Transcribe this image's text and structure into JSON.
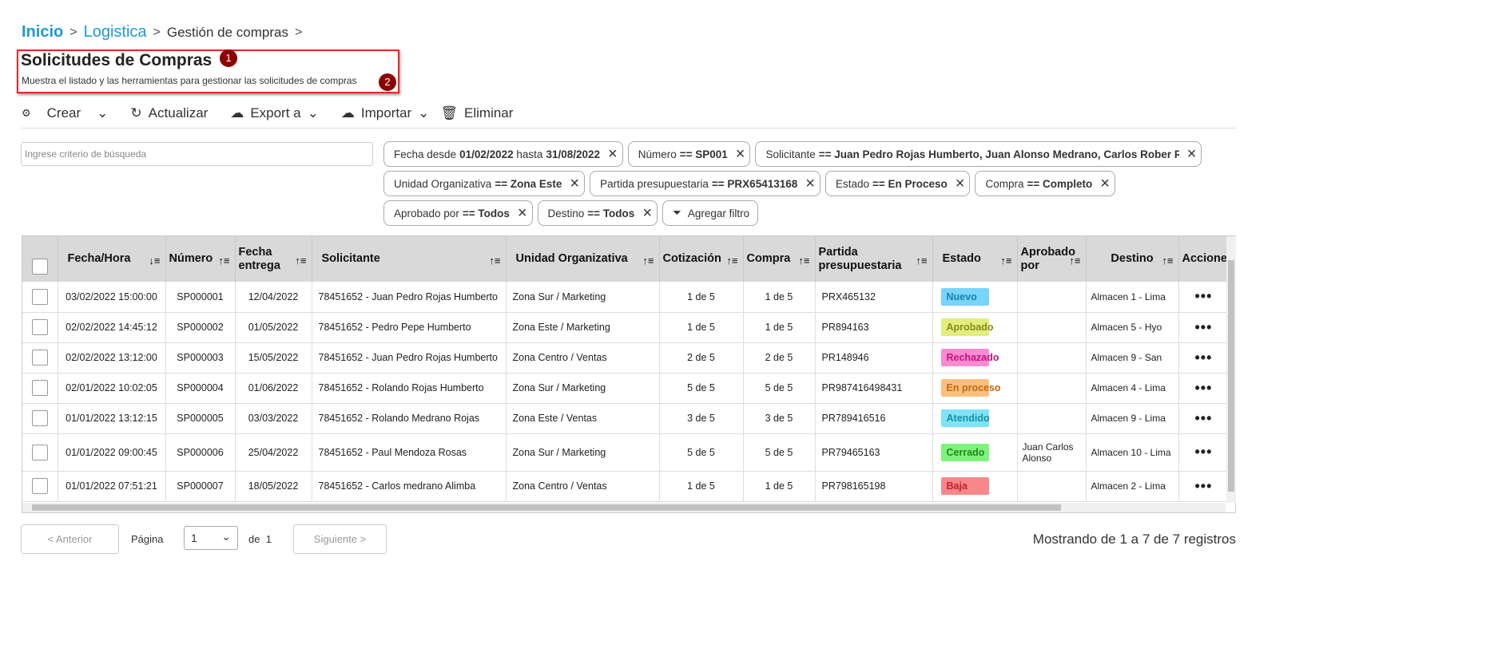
{
  "breadcrumb": [
    "Inicio",
    "Logistica",
    "Gestión de compras"
  ],
  "header": {
    "title": "Solicitudes de Compras",
    "subtitle": "Muestra el listado y las herramientas para gestionar las solicitudes de compras",
    "marker1": "1",
    "marker2": "2"
  },
  "toolbar": {
    "create": "Crear",
    "refresh": "Actualizar",
    "export": "Export a",
    "import": "Importar",
    "delete": "Eliminar"
  },
  "search": {
    "placeholder": "Ingrese criterio de búsqueda",
    "value": ""
  },
  "filters": [
    {
      "label": "Fecha desde",
      "value": "01/02/2022",
      "mid": "hasta",
      "value2": "31/08/2022"
    },
    {
      "label": "Número",
      "value": "== SP001"
    },
    {
      "label": "Solicitante",
      "value": "== Juan Pedro Rojas Humberto, Juan Alonso Medrano, Carlos Rober Ren"
    },
    {
      "label": "Unidad Organizativa",
      "value": "== Zona Este"
    },
    {
      "label": "Partida presupuestaria",
      "value": "== PRX65413168"
    },
    {
      "label": "Estado",
      "value": "== En Proceso"
    },
    {
      "label": "Compra",
      "value": "== Completo"
    },
    {
      "label": "Aprobado por",
      "value": "== Todos"
    },
    {
      "label": "Destino",
      "value": "== Todos"
    }
  ],
  "add_filter": "Agregar filtro",
  "columns": [
    "Fecha/Hora",
    "Número",
    "Fecha entrega",
    "Solicitante",
    "Unidad Organizativa",
    "Cotización",
    "Compra",
    "Partida presupuestaria",
    "Estado",
    "Aprobado por",
    "Destino",
    "Acciones"
  ],
  "rows": [
    [
      "03/02/2022 15:00:00",
      "SP000001",
      "12/04/2022",
      "78451652 - Juan Pedro Rojas Humberto",
      "Zona Sur / Marketing",
      "1 de 5",
      "1 de 5",
      "PRX465132",
      "Nuevo",
      "",
      "Almacen 1 - Lima"
    ],
    [
      "02/02/2022 14:45:12",
      "SP000002",
      "01/05/2022",
      "78451652 - Pedro Pepe Humberto",
      "Zona Este / Marketing",
      "1 de 5",
      "1 de 5",
      "PR894163",
      "Aprobado",
      "",
      "Almacen 5 - Hyo"
    ],
    [
      "02/02/2022 13:12:00",
      "SP000003",
      "15/05/2022",
      "78451652 - Juan Pedro Rojas Humberto",
      "Zona Centro / Ventas",
      "2 de 5",
      "2 de 5",
      "PR148946",
      "Rechazado",
      "",
      "Almacen 9 - San"
    ],
    [
      "02/01/2022 10:02:05",
      "SP000004",
      "01/06/2022",
      "78451652 - Rolando Rojas Humberto",
      "Zona Sur / Marketing",
      "5 de 5",
      "5 de 5",
      "PR987416498431",
      "En proceso",
      "",
      "Almacen 4 - Lima"
    ],
    [
      "01/01/2022 13:12:15",
      "SP000005",
      "03/03/2022",
      "78451652 - Rolando Medrano Rojas",
      "Zona Este / Ventas",
      "3 de 5",
      "3 de 5",
      "PR789416516",
      "Atendido",
      "",
      "Almacen 9 - Lima"
    ],
    [
      "01/01/2022 09:00:45",
      "SP000006",
      "25/04/2022",
      "78451652 - Paul Mendoza Rosas",
      "Zona Sur / Marketing",
      "5 de 5",
      "5 de 5",
      "PR79465163",
      "Cerrado",
      "Juan Carlos Alonso",
      "Almacen 10 - Lima"
    ],
    [
      "01/01/2022 07:51:21",
      "SP000007",
      "18/05/2022",
      "78451652 - Carlos medrano Alimba",
      "Zona Centro / Ventas",
      "1 de 5",
      "1 de 5",
      "PR798165198",
      "Baja",
      "",
      "Almacen 2 - Lima"
    ]
  ],
  "status_colors": {
    "Nuevo": [
      "#79d4fb",
      "#1a7fae"
    ],
    "Aprobado": [
      "#e2ed7c",
      "#878a1c"
    ],
    "Rechazado": [
      "#f98bd0",
      "#c4127f"
    ],
    "En proceso": [
      "#fbc07e",
      "#c0680e"
    ],
    "Atendido": [
      "#7de4f6",
      "#168fa8"
    ],
    "Cerrado": [
      "#7ef27a",
      "#1c8a1c"
    ],
    "Baja": [
      "#f8878b",
      "#c0202a"
    ]
  },
  "pagination": {
    "prev": "< Anterior",
    "page_label": "Página",
    "page": "1",
    "of": "de",
    "total_pages": "1",
    "next": "Siguiente >",
    "summary": "Mostrando de 1 a 7 de  7 registros"
  }
}
